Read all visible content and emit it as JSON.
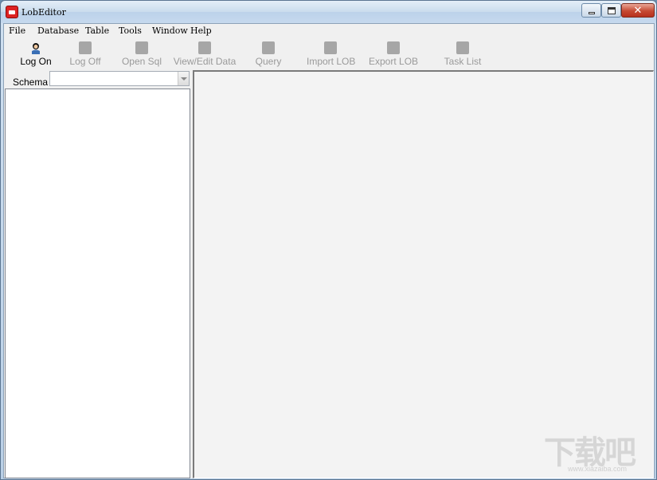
{
  "window": {
    "title": "LobEditor"
  },
  "menu": [
    "File",
    "Database",
    "Table",
    "Tools",
    "Window",
    "Help"
  ],
  "toolbar": {
    "log_on": "Log On",
    "log_off": "Log Off",
    "open_sql": "Open Sql",
    "view_edit_data": "View/Edit Data",
    "query": "Query",
    "import_lob": "Import LOB",
    "export_lob": "Export LOB",
    "task_list": "Task List"
  },
  "schema": {
    "label": "Schema",
    "value": ""
  },
  "watermark": {
    "text": "下载吧",
    "url": "www.xiazaiba.com"
  },
  "colors": {
    "close_button": "#c64a33",
    "disabled_text": "#9a9a9a",
    "main_area": "#f3f3f3"
  }
}
